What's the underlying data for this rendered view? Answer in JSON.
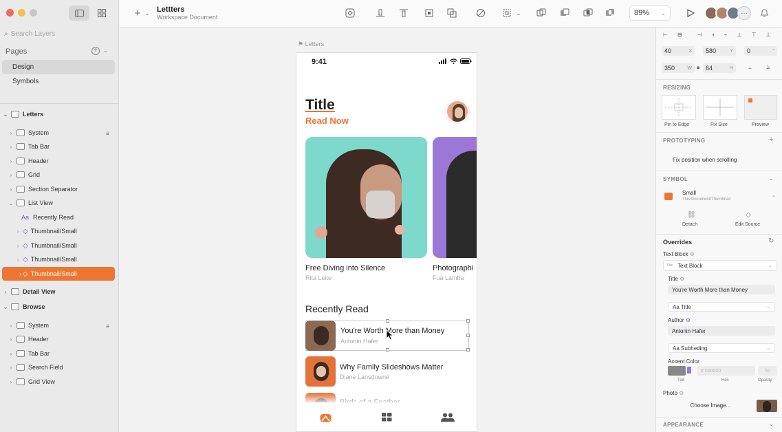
{
  "sidebar": {
    "search_placeholder": "Search Layers",
    "pages_header": "Pages",
    "pages": [
      {
        "label": "Design"
      },
      {
        "label": "Symbols"
      }
    ],
    "letters_group": "Letters",
    "letters_layers": [
      {
        "label": "System"
      },
      {
        "label": "Tab Bar"
      },
      {
        "label": "Header"
      },
      {
        "label": "Grid"
      },
      {
        "label": "Section Separator"
      },
      {
        "label": "List View"
      }
    ],
    "list_view_children": [
      {
        "label": "Recently Read"
      },
      {
        "label": "Thumbnail/Small"
      },
      {
        "label": "Thumbnail/Small"
      },
      {
        "label": "Thumbnail/Small"
      },
      {
        "label": "Thumbnail/Small"
      }
    ],
    "detail_view": "Detail View",
    "browse_group": "Browse",
    "browse_layers": [
      {
        "label": "System"
      },
      {
        "label": "Header"
      },
      {
        "label": "Tab Bar"
      },
      {
        "label": "Search Field"
      },
      {
        "label": "Grid View"
      }
    ]
  },
  "toolbar": {
    "doc_title": "Lettters",
    "doc_subtitle": "Workspace Document",
    "zoom": "89%"
  },
  "canvas": {
    "artboard_label": "Letters",
    "status_time": "9:41",
    "title": "Title",
    "read_now": "Read Now",
    "cards": [
      {
        "title": "Free Diving into Silence",
        "author": "Rita Leite"
      },
      {
        "title": "Photographi",
        "author": "Fua Lamba"
      }
    ],
    "recently_read": "Recently Read",
    "list": [
      {
        "title": "You're Worth More than Money",
        "author": "Antonin Hafer"
      },
      {
        "title": "Why Family Slideshows Matter",
        "author": "Diane Lansdowne"
      },
      {
        "title": "Birds of a Feather",
        "author": ""
      }
    ]
  },
  "inspector": {
    "x": "40",
    "x_unit": "X",
    "y": "580",
    "y_unit": "Y",
    "rot": "0",
    "rot_unit": "°",
    "w": "350",
    "w_unit": "W",
    "h": "64",
    "h_unit": "H",
    "resizing": "RESIZING",
    "pin_to_edge": "Pin to Edge",
    "fix_size": "Fix Size",
    "preview": "Preview",
    "prototyping": "PROTOTYPING",
    "fix_position": "Fix position when scrolling",
    "symbol_header": "SYMBOL",
    "symbol_name": "Small",
    "symbol_path": "This Document/Thumbnail",
    "detach": "Detach",
    "edit_source": "Edit Source",
    "overrides": "Overrides",
    "text_block_label": "Text Block",
    "text_block_value": "Text Block",
    "title_label": "Title",
    "title_value": "You're Worth More than Money",
    "title_style": "Aa Title",
    "author_label": "Author",
    "author_value": "Antonin Hafer",
    "author_style": "Aa Subheding",
    "accent_label": "Accent Color",
    "hex_value": "000000",
    "opacity_value": "50",
    "tint": "Tint",
    "hex": "Hex",
    "opacity": "Opacity",
    "photo_label": "Photo",
    "choose_image": "Choose Image...",
    "appearance": "APPEARANCE"
  },
  "colors": {
    "accent": "#ee7633",
    "symbol": "#7b53e6",
    "teal": "#7dd9cc",
    "purple": "#9b78d8"
  }
}
